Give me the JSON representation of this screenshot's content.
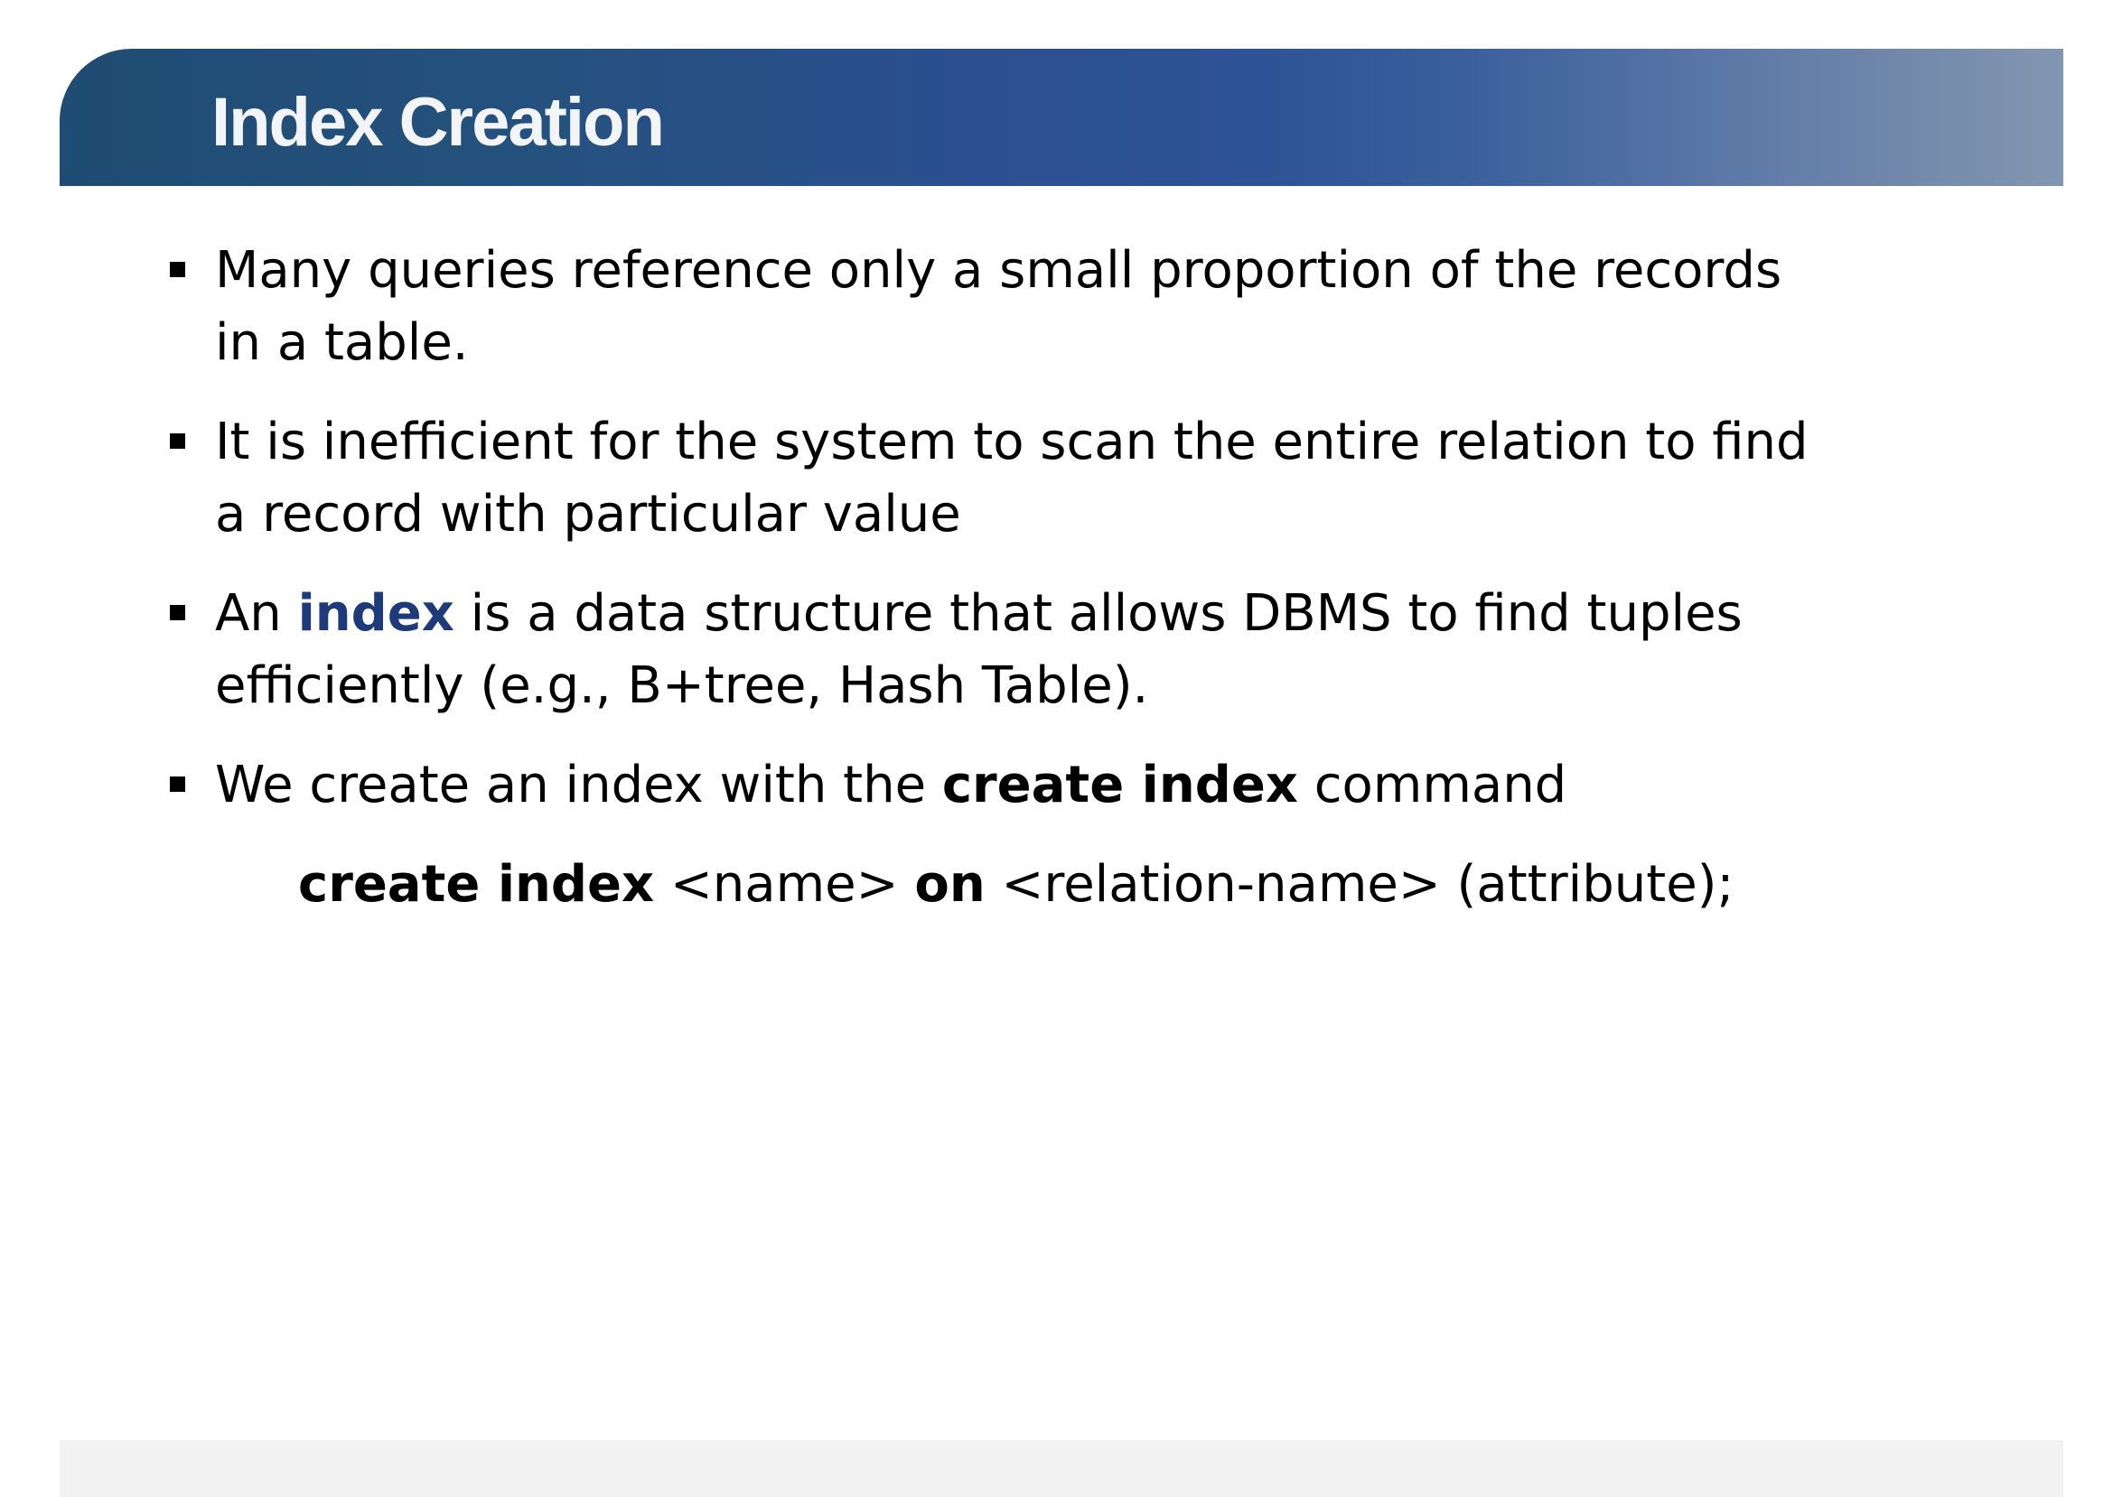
{
  "slide": {
    "title": "Index Creation",
    "bullets": [
      {
        "lines": [
          "Many queries reference only a small proportion of the records",
          "in a table."
        ]
      },
      {
        "lines": [
          "It is inefficient for the system to scan the entire relation to find",
          "a record with particular value"
        ]
      },
      {
        "prefix": "An ",
        "term": "index",
        "suffix": " is a data structure that allows DBMS to find  tuples",
        "line2": "efficiently (e.g., B+tree, Hash Table)."
      },
      {
        "prefix": "We create an index with the ",
        "keyword": "create index",
        "suffix": " command"
      }
    ],
    "syntax": {
      "kw1": "create index",
      "part1": " <name> ",
      "kw2": "on",
      "part2": " <relation-name> (attribute);"
    }
  },
  "colors": {
    "title_bar_start": "#1f4c72",
    "title_bar_end": "#8197b0",
    "title_text": "#f2f4f7",
    "term_highlight": "#1f3a78",
    "footer_band": "#f2f2f2"
  }
}
